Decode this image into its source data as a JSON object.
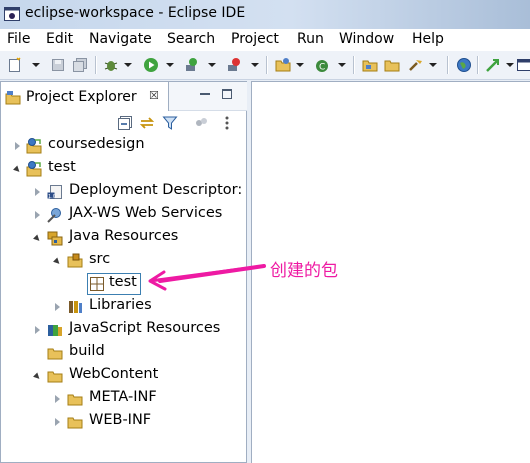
{
  "window": {
    "title": "eclipse-workspace - Eclipse IDE",
    "title_icon": "eclipse-icon"
  },
  "menubar": {
    "items": [
      "File",
      "Edit",
      "Navigate",
      "Search",
      "Project",
      "Run",
      "Window",
      "Help"
    ]
  },
  "explorer": {
    "tab_label": "Project Explorer",
    "tab_close": "☒",
    "tree": [
      {
        "label": "coursedesign",
        "state": "collapsed",
        "icon": "web-project-icon"
      },
      {
        "label": "test",
        "state": "expanded",
        "icon": "web-project-icon"
      },
      {
        "label": "Deployment Descriptor: ",
        "state": "collapsed",
        "icon": "deployment-descriptor-icon"
      },
      {
        "label": "JAX-WS Web Services",
        "state": "collapsed",
        "icon": "web-services-icon"
      },
      {
        "label": "Java Resources",
        "state": "expanded",
        "icon": "java-resources-icon"
      },
      {
        "label": "src",
        "state": "expanded",
        "icon": "source-folder-icon"
      },
      {
        "label": "test",
        "state": "leaf",
        "icon": "package-icon",
        "selected": true
      },
      {
        "label": "Libraries",
        "state": "collapsed",
        "icon": "libraries-icon"
      },
      {
        "label": "JavaScript Resources",
        "state": "collapsed",
        "icon": "javascript-resources-icon"
      },
      {
        "label": "build",
        "state": "leaf",
        "icon": "folder-icon"
      },
      {
        "label": "WebContent",
        "state": "expanded",
        "icon": "folder-icon"
      },
      {
        "label": "META-INF",
        "state": "collapsed",
        "icon": "folder-icon"
      },
      {
        "label": "WEB-INF",
        "state": "collapsed",
        "icon": "folder-icon"
      }
    ]
  },
  "annotation": {
    "text": "创建的包",
    "color": "#ee1aa3"
  },
  "colors": {
    "selection_border": "#3c7fb1",
    "arrow": "#ee1aa3"
  }
}
